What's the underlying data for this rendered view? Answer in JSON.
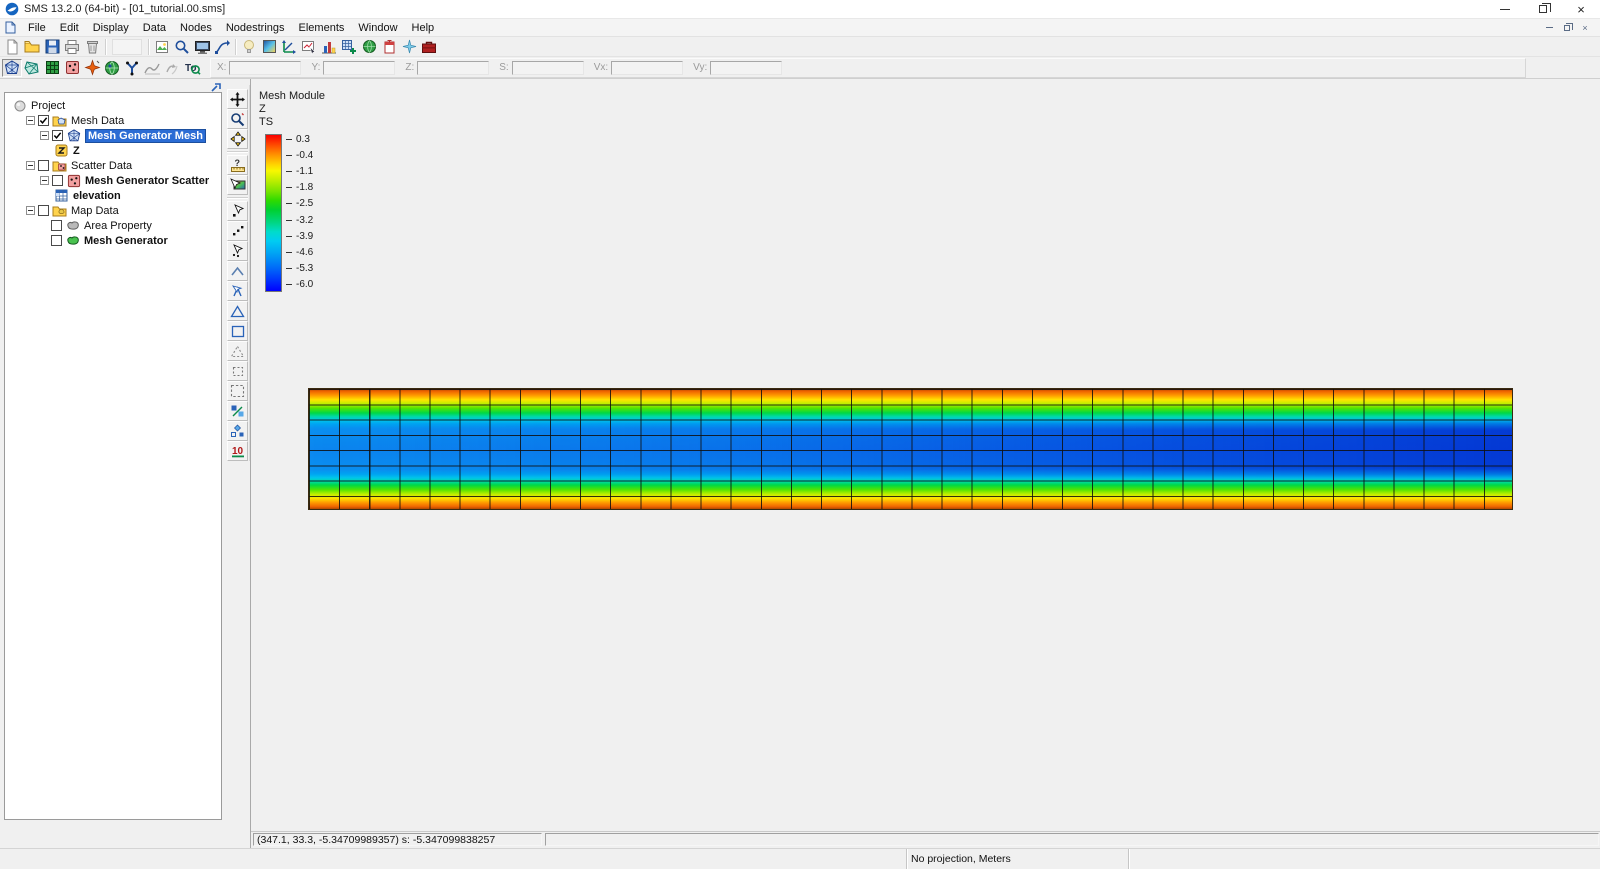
{
  "window": {
    "title": "SMS 13.2.0 (64-bit) - [01_tutorial.00.sms]",
    "status_coordinates": "(347.1, 33.3, -5.34709989357) s: -5.347099838257",
    "status_projection": "No projection, Meters"
  },
  "menu": {
    "items": [
      "File",
      "Edit",
      "Display",
      "Data",
      "Nodes",
      "Nodestrings",
      "Elements",
      "Window",
      "Help"
    ]
  },
  "edit_bar": {
    "labels": [
      "X:",
      "Y:",
      "Z:",
      "S:",
      "Vx:",
      "Vy:"
    ]
  },
  "project_tree": {
    "items": [
      {
        "label": "Project"
      },
      {
        "label": "Mesh Data",
        "checked": true
      },
      {
        "label": "Mesh Generator Mesh",
        "checked": true,
        "selected": true
      },
      {
        "label": "Z"
      },
      {
        "label": "Scatter Data",
        "checked": false
      },
      {
        "label": "Mesh Generator Scatter",
        "checked": false
      },
      {
        "label": "elevation"
      },
      {
        "label": "Map Data",
        "checked": false
      },
      {
        "label": "Area Property",
        "checked": false
      },
      {
        "label": "Mesh Generator",
        "checked": false
      }
    ]
  },
  "legend": {
    "module": "Mesh Module",
    "dataset": "Z",
    "timestep": "TS",
    "ticks": [
      "0.3",
      "-0.4",
      "-1.1",
      "-1.8",
      "-2.5",
      "-3.2",
      "-3.9",
      "-4.6",
      "-5.3",
      "-6.0"
    ]
  },
  "mesh_view": {
    "columns": 40,
    "rows": 8,
    "min_value": -6.0,
    "max_value": 0.3
  },
  "icons": {
    "time_module": "To",
    "renumber": "10",
    "measure": "?"
  }
}
